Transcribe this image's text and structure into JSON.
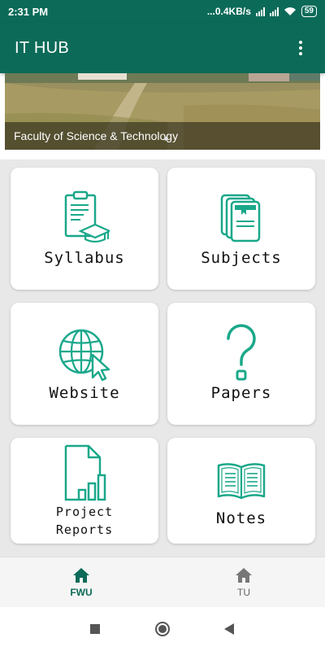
{
  "status_bar": {
    "time": "2:31 PM",
    "network_speed": "...0.4KB/s",
    "battery": "59"
  },
  "app_bar": {
    "title": "IT HUB",
    "menu_icon": "more-vert-icon"
  },
  "banner": {
    "caption": "Faculty of Science & Technology"
  },
  "menu": {
    "syllabus": {
      "label": "Syllabus",
      "icon": "clipboard-graduation-icon"
    },
    "subjects": {
      "label": "Subjects",
      "icon": "books-icon"
    },
    "website": {
      "label": "Website",
      "icon": "globe-cursor-icon"
    },
    "papers": {
      "label": "Papers",
      "icon": "question-mark-icon"
    },
    "project_reports": {
      "label_line1": "Project",
      "label_line2": "Reports",
      "icon": "report-chart-icon"
    },
    "notes": {
      "label": "Notes",
      "icon": "open-book-icon"
    }
  },
  "bottom_nav": {
    "fwu": {
      "label": "FWU",
      "icon": "home-icon",
      "active": true
    },
    "tu": {
      "label": "TU",
      "icon": "home-icon",
      "active": false
    }
  },
  "colors": {
    "primary": "#0b6b58",
    "icon_accent": "#1aa88a",
    "grid_background": "#e8e8e8"
  }
}
